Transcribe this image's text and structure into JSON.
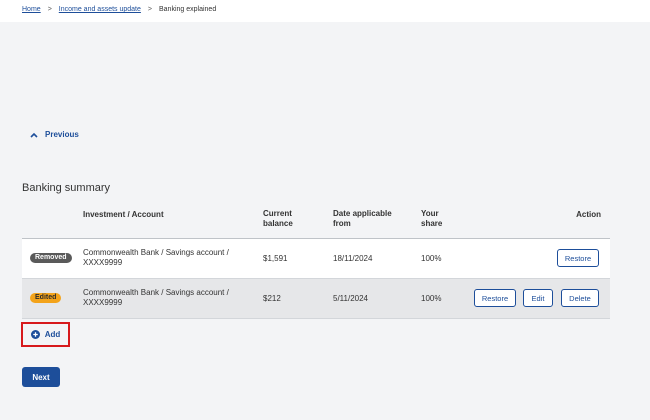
{
  "breadcrumb": {
    "items": [
      {
        "label": "Home"
      },
      {
        "label": "Income and assets update"
      },
      {
        "label": "Banking explained"
      }
    ],
    "separator": ">"
  },
  "nav": {
    "previous_label": "Previous"
  },
  "summary": {
    "title": "Banking summary",
    "columns": {
      "account": "Investment / Account",
      "balance_line1": "Current",
      "balance_line2": "balance",
      "date_line1": "Date applicable",
      "date_line2": "from",
      "share_line1": "Your",
      "share_line2": "share",
      "action": "Action"
    },
    "rows": [
      {
        "status": "Removed",
        "account_line1": "Commonwealth Bank / Savings account /",
        "account_line2": "XXXX9999",
        "balance": "$1,591",
        "date": "18/11/2024",
        "share": "100%",
        "actions": {
          "restore": "Restore"
        }
      },
      {
        "status": "Edited",
        "account_line1": "Commonwealth Bank / Savings account /",
        "account_line2": "XXXX9999",
        "balance": "$212",
        "date": "5/11/2024",
        "share": "100%",
        "actions": {
          "restore": "Restore",
          "edit": "Edit",
          "delete": "Delete"
        }
      }
    ]
  },
  "add_button": {
    "label": "Add",
    "icon": "plus-circle-icon"
  },
  "next_button": {
    "label": "Next"
  },
  "colors": {
    "link": "#1d4e9a",
    "primary": "#1d4e9a",
    "removed_badge": "#5a5a5a",
    "edited_badge": "#f3a31a",
    "highlight_border": "#d7191c",
    "background": "#f3f4f6"
  }
}
